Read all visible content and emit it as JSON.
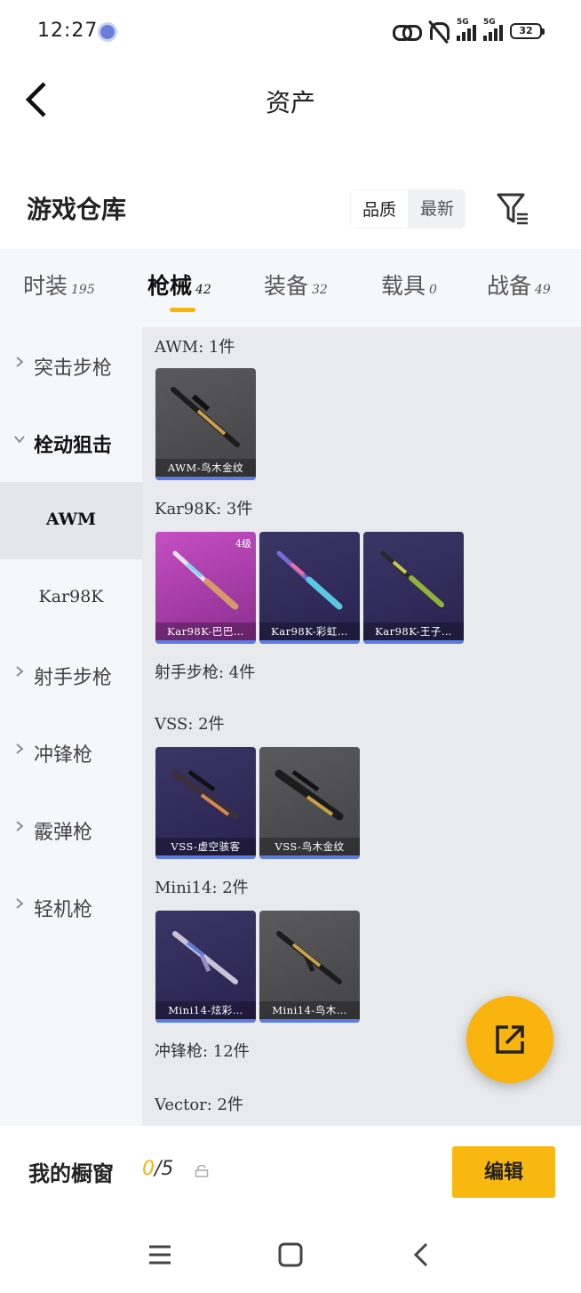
{
  "status_bar": {
    "time": "12:27",
    "network_label": "5G",
    "battery": "32"
  },
  "header": {
    "title": "资产"
  },
  "warehouse": {
    "title": "游戏仓库",
    "sort_options": [
      {
        "label": "品质",
        "active": true
      },
      {
        "label": "最新",
        "active": false
      }
    ]
  },
  "tabs": [
    {
      "label": "时装",
      "count": "195",
      "active": false
    },
    {
      "label": "枪械",
      "count": "42",
      "active": true
    },
    {
      "label": "装备",
      "count": "32",
      "active": false
    },
    {
      "label": "载具",
      "count": "0",
      "active": false
    },
    {
      "label": "战备",
      "count": "49",
      "active": false
    }
  ],
  "sidebar": {
    "items": [
      {
        "label": "突击步枪",
        "type": "category",
        "expanded": false
      },
      {
        "label": "栓动狙击",
        "type": "category",
        "expanded": true
      },
      {
        "label": "AWM",
        "type": "sub",
        "selected": true
      },
      {
        "label": "Kar98K",
        "type": "sub",
        "selected": false
      },
      {
        "label": "射手步枪",
        "type": "category",
        "expanded": false
      },
      {
        "label": "冲锋枪",
        "type": "category",
        "expanded": false
      },
      {
        "label": "霰弹枪",
        "type": "category",
        "expanded": false
      },
      {
        "label": "轻机枪",
        "type": "category",
        "expanded": false
      }
    ]
  },
  "content": {
    "groups": [
      {
        "label": "AWM: 1件",
        "cards": [
          {
            "name": "AWM-鸟木金纹",
            "style": "gray",
            "badge": ""
          }
        ]
      },
      {
        "label": "Kar98K: 3件",
        "cards": [
          {
            "name": "Kar98K-巴巴…",
            "style": "pink",
            "badge": "4级"
          },
          {
            "name": "Kar98K-彩虹…",
            "style": "purple",
            "badge": ""
          },
          {
            "name": "Kar98K-王子…",
            "style": "purple",
            "badge": ""
          }
        ]
      },
      {
        "label": "射手步枪: 4件",
        "cards": []
      },
      {
        "label": "VSS: 2件",
        "cards": [
          {
            "name": "VSS-虚空骇客",
            "style": "purple",
            "badge": ""
          },
          {
            "name": "VSS-鸟木金纹",
            "style": "gray",
            "badge": ""
          }
        ]
      },
      {
        "label": "Mini14: 2件",
        "cards": [
          {
            "name": "Mini14-炫彩…",
            "style": "purple",
            "badge": ""
          },
          {
            "name": "Mini14-鸟木…",
            "style": "gray",
            "badge": ""
          }
        ]
      },
      {
        "label": "冲锋枪: 12件",
        "cards": []
      },
      {
        "label": "Vector: 2件",
        "cards": []
      }
    ]
  },
  "showcase": {
    "label": "我的橱窗",
    "current": "0",
    "total": "/5",
    "edit_label": "编辑"
  },
  "colors": {
    "accent": "#f9b80f",
    "rarity_bar": "#5b7de3"
  },
  "icons": {
    "fab": "share-external-icon",
    "filter": "filter-icon",
    "lock": "lock-icon",
    "nav": [
      "menu-icon",
      "home-icon",
      "back-icon"
    ]
  }
}
